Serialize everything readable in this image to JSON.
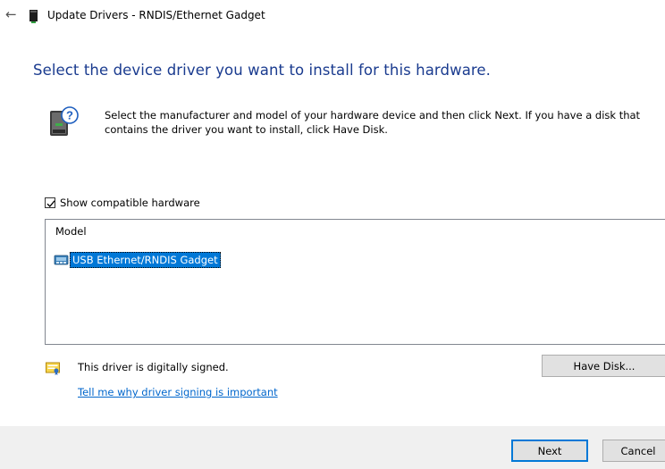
{
  "window": {
    "back_icon": "back-arrow-icon",
    "app_icon": "device-icon",
    "title": "Update Drivers - RNDIS/Ethernet Gadget"
  },
  "main": {
    "heading": "Select the device driver you want to install for this hardware.",
    "hardware_icon": "hardware-question-icon",
    "instructions": "Select the manufacturer and model of your hardware device and then click Next. If you have a disk that contains the driver you want to install, click Have Disk.",
    "show_compatible": {
      "label": "Show compatible hardware",
      "checked": true
    },
    "model_list": {
      "header": "Model",
      "items": [
        {
          "label": "USB Ethernet/RNDIS Gadget",
          "selected": true,
          "icon": "network-adapter-icon"
        }
      ]
    },
    "signature": {
      "icon": "signed-certificate-icon",
      "text": "This driver is digitally signed.",
      "link": "Tell me why driver signing is important"
    },
    "have_disk_label": "Have Disk..."
  },
  "footer": {
    "next_label": "Next",
    "cancel_label": "Cancel"
  },
  "colors": {
    "heading": "#1a3b8f",
    "selection": "#0078d7",
    "link": "#0066cc",
    "footer_bg": "#f0f0f0"
  }
}
